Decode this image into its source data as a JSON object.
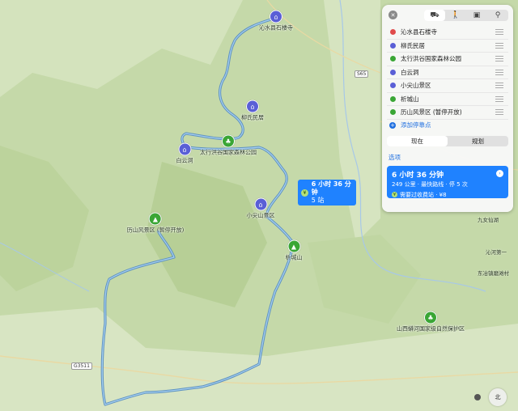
{
  "map": {
    "pois": [
      {
        "name": "沁水县石楼寺",
        "type": "temple",
        "color": "#5a5fd6"
      },
      {
        "name": "柳氏民居",
        "type": "temple",
        "color": "#5a5fd6"
      },
      {
        "name": "太行洪谷国家森林公园",
        "type": "park",
        "color": "#3aa635"
      },
      {
        "name": "白云洞",
        "type": "temple",
        "color": "#5a5fd6"
      },
      {
        "name": "小尖山景区",
        "type": "temple",
        "color": "#5a5fd6"
      },
      {
        "name": "析城山",
        "type": "mountain",
        "color": "#3aa635"
      },
      {
        "name": "历山风景区 (暂停开放)",
        "type": "mountain",
        "color": "#3aa635"
      },
      {
        "name": "山西蟒河国家级自然保护区",
        "type": "park",
        "color": "#3aa635"
      }
    ],
    "edge_labels": [
      "九女仙湖",
      "沁河第一",
      "东冶镇磨滩村"
    ],
    "road_shields": [
      "S65",
      "G3511"
    ],
    "route_badge": {
      "time": "6 小时 36 分钟",
      "stops": "5 站"
    },
    "compass": "北"
  },
  "panel": {
    "modes": [
      "car-icon",
      "walk-icon",
      "transit-icon",
      "bike-icon"
    ],
    "stops": [
      {
        "name": "沁水县石楼寺",
        "color": "#e04b4b"
      },
      {
        "name": "柳氏民居",
        "color": "#5a5fd6"
      },
      {
        "name": "太行洪谷国家森林公园",
        "color": "#3aa635"
      },
      {
        "name": "白云洞",
        "color": "#5a5fd6"
      },
      {
        "name": "小尖山景区",
        "color": "#5a5fd6"
      },
      {
        "name": "析城山",
        "color": "#3aa635"
      },
      {
        "name": "历山风景区 (暂停开放)",
        "color": "#3aa635"
      }
    ],
    "add_stop": "添加停靠点",
    "segments": [
      "现在",
      "规划"
    ],
    "options_label": "选项",
    "route": {
      "time": "6 小时 36 分钟",
      "detail": "249 公里 · 最快路线 · 停 5 次",
      "toll": "需要过收费站 · ¥8"
    }
  }
}
